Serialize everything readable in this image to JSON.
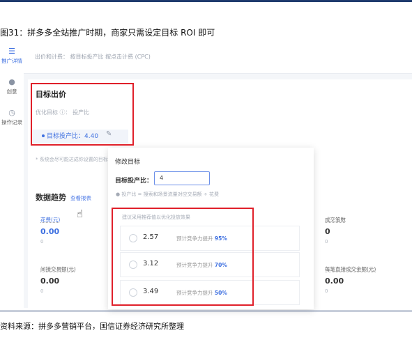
{
  "figure": {
    "caption": "图31：拼多多全站推广时期，商家只需设定目标 ROI 即可",
    "source": "资料来源：拼多多营销平台，国信证券经济研究所整理"
  },
  "sidebar": {
    "items": [
      {
        "label": "推广详情",
        "icon": "list-icon",
        "active": true
      },
      {
        "label": "创意",
        "icon": "bulb-icon",
        "active": false
      },
      {
        "label": "操作记录",
        "icon": "clock-icon",
        "active": false
      }
    ]
  },
  "header": {
    "bid_line": "出价和计费：  按目标投产比  按点击计费 (CPC)"
  },
  "target_bid": {
    "title": "目标出价",
    "optimize_line": "优化目标 ⓘ：  投产比",
    "roi_label": "目标投产比：4.40",
    "edit_icon": "edit-icon",
    "system_note": "* 系统会尽可能达成你设置的目标投产比"
  },
  "trend": {
    "title": "数据趋势",
    "report_link": "查看报表",
    "metrics_left": [
      {
        "label": "花费(元)",
        "value": "0.00",
        "sub": "0",
        "highlight": true
      },
      {
        "label": "间接交易额(元)",
        "value": "0.00",
        "sub": "0",
        "highlight": false
      }
    ],
    "metrics_right": [
      {
        "label": "成交笔数",
        "value": "0",
        "sub": "0"
      },
      {
        "label": "每笔直接成交金额(元)",
        "value": "0.00",
        "sub": "0"
      }
    ]
  },
  "popup": {
    "title": "修改目标",
    "roi_label": "目标投产比：",
    "roi_value": "4",
    "formula_note": "● 投产比 = 搜索和场景流量对应交易额 ÷ 花费",
    "suggest_note": "建议采用推荐值以优化投放效果",
    "options": [
      {
        "value": "2.57",
        "gain_text": "预计竞争力提升",
        "gain_pct": "95%"
      },
      {
        "value": "3.12",
        "gain_text": "预计竞争力提升",
        "gain_pct": "70%"
      },
      {
        "value": "3.49",
        "gain_text": "预计竞争力提升",
        "gain_pct": "50%"
      }
    ]
  },
  "colors": {
    "accent": "#3d6fe0",
    "highlight_box": "#e0202a",
    "rule": "#1f3b6e"
  }
}
